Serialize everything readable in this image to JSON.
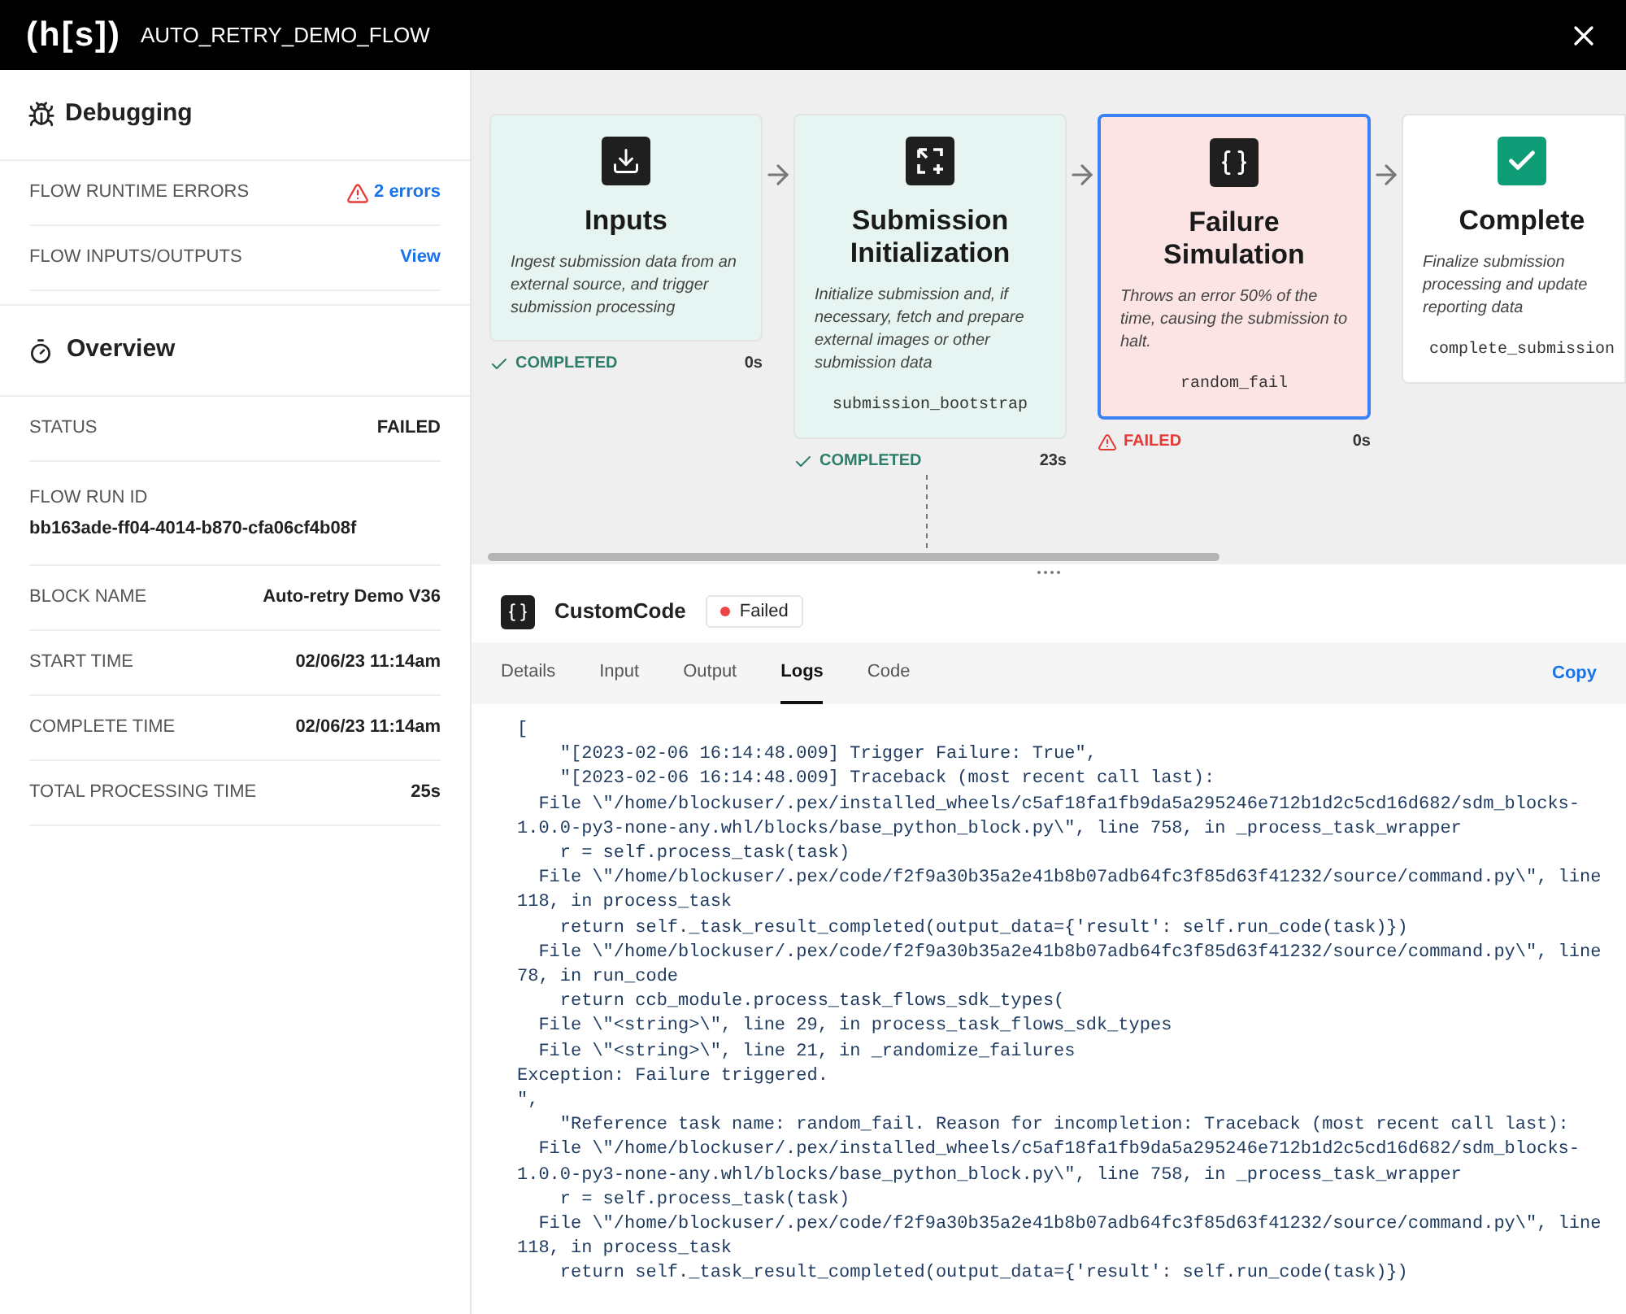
{
  "header": {
    "logo": "(h[s])",
    "title": "AUTO_RETRY_DEMO_FLOW"
  },
  "debugging": {
    "title": "Debugging",
    "rows": [
      {
        "label": "FLOW RUNTIME ERRORS",
        "value": "2 errors",
        "kind": "error-link"
      },
      {
        "label": "FLOW INPUTS/OUTPUTS",
        "value": "View",
        "kind": "link"
      }
    ]
  },
  "overview": {
    "title": "Overview",
    "rows": [
      {
        "label": "STATUS",
        "value": "FAILED",
        "kind": "inline"
      },
      {
        "label": "FLOW RUN ID",
        "value": "bb163ade-ff04-4014-b870-cfa06cf4b08f",
        "kind": "stacked"
      },
      {
        "label": "BLOCK NAME",
        "value": "Auto-retry Demo V36",
        "kind": "inline"
      },
      {
        "label": "START TIME",
        "value": "02/06/23 11:14am",
        "kind": "inline"
      },
      {
        "label": "COMPLETE TIME",
        "value": "02/06/23 11:14am",
        "kind": "inline"
      },
      {
        "label": "TOTAL PROCESSING TIME",
        "value": "25s",
        "kind": "inline"
      }
    ]
  },
  "flow": {
    "nodes": [
      {
        "kind": "download",
        "title": "Inputs",
        "description": "Ingest submission data from an external source, and trigger submission processing",
        "completed": true,
        "failed": false,
        "status_label": "COMPLETED",
        "duration": "0s",
        "selected": false
      },
      {
        "kind": "transform",
        "title": "Submission Initialization",
        "description": "Initialize submission and, if necessary, fetch and prepare external images or other submission data",
        "code": "submission_bootstrap",
        "completed": true,
        "failed": false,
        "status_label": "COMPLETED",
        "duration": "23s",
        "selected": false
      },
      {
        "kind": "code",
        "title": "Failure Simulation",
        "description": "Throws an error 50% of the time, causing the submission to halt.",
        "code": "random_fail",
        "completed": false,
        "failed": true,
        "status_label": "FAILED",
        "duration": "0s",
        "selected": true
      },
      {
        "kind": "check",
        "title": "Complete",
        "description": "Finalize submission processing and update reporting data",
        "code": "complete_submission",
        "completed": false,
        "failed": false,
        "selected": false
      }
    ]
  },
  "panel": {
    "title": "CustomCode",
    "failed": true,
    "status_label": "Failed",
    "tabs": [
      {
        "label": "Details",
        "selected": false
      },
      {
        "label": "Input",
        "selected": false
      },
      {
        "label": "Output",
        "selected": false
      },
      {
        "label": "Logs",
        "selected": true
      },
      {
        "label": "Code",
        "selected": false
      }
    ],
    "copy": "Copy",
    "log_lines": [
      "[",
      "    \"[2023-02-06 16:14:48.009] Trigger Failure: True\",",
      "    \"[2023-02-06 16:14:48.009] Traceback (most recent call last):",
      "  File \\\"/home/blockuser/.pex/installed_wheels/c5af18fa1fb9da5a295246e712b1d2c5cd16d682/sdm_blocks-",
      "1.0.0-py3-none-any.whl/blocks/base_python_block.py\\\", line 758, in _process_task_wrapper",
      "    r = self.process_task(task)",
      "  File \\\"/home/blockuser/.pex/code/f2f9a30b35a2e41b8b07adb64fc3f85d63f41232/source/command.py\\\", line",
      "118, in process_task",
      "    return self._task_result_completed(output_data={'result': self.run_code(task)})",
      "  File \\\"/home/blockuser/.pex/code/f2f9a30b35a2e41b8b07adb64fc3f85d63f41232/source/command.py\\\", line",
      "78, in run_code",
      "    return ccb_module.process_task_flows_sdk_types(",
      "  File \\\"<string>\\\", line 29, in process_task_flows_sdk_types",
      "  File \\\"<string>\\\", line 21, in _randomize_failures",
      "Exception: Failure triggered.",
      "\",",
      "    \"Reference task name: random_fail. Reason for incompletion: Traceback (most recent call last):",
      "  File \\\"/home/blockuser/.pex/installed_wheels/c5af18fa1fb9da5a295246e712b1d2c5cd16d682/sdm_blocks-",
      "1.0.0-py3-none-any.whl/blocks/base_python_block.py\\\", line 758, in _process_task_wrapper",
      "    r = self.process_task(task)",
      "  File \\\"/home/blockuser/.pex/code/f2f9a30b35a2e41b8b07adb64fc3f85d63f41232/source/command.py\\\", line",
      "118, in process_task",
      "    return self._task_result_completed(output_data={'result': self.run_code(task)})"
    ]
  }
}
